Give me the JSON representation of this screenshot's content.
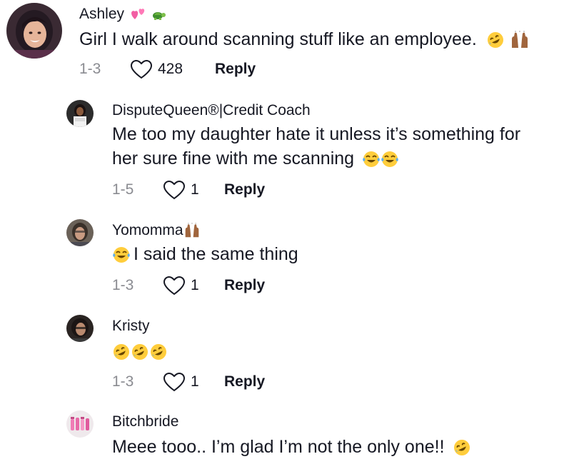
{
  "comments": [
    {
      "username": "Ashley",
      "text": "Girl I walk around scanning stuff like an employee.",
      "date": "1-3",
      "likes": "428",
      "reply_label": "Reply",
      "username_emojis": [
        "two-hearts",
        "turtle"
      ],
      "text_emojis": [
        "rofl",
        "raised-hands"
      ]
    },
    {
      "username": "DisputeQueen®|Credit  Coach",
      "text_line1": "Me too my daughter hate it unless it’s something for",
      "text_line2": "her sure fine with me scanning",
      "date": "1-5",
      "likes": "1",
      "reply_label": "Reply",
      "text_emojis": [
        "tears-of-joy",
        "tears-of-joy"
      ]
    },
    {
      "username": "Yomomma",
      "text": "I said the same thing",
      "date": "1-3",
      "likes": "1",
      "reply_label": "Reply",
      "username_emojis": [
        "raised-hands"
      ],
      "text_emojis": [
        "tears-of-joy"
      ]
    },
    {
      "username": "Kristy",
      "text": "",
      "date": "1-3",
      "likes": "1",
      "reply_label": "Reply",
      "text_emojis": [
        "rofl",
        "rofl",
        "rofl"
      ]
    },
    {
      "username": "Bitchbride",
      "text": "Meee tooo.. I’m glad I’m not the only one!!",
      "text_emojis": [
        "rofl"
      ]
    }
  ],
  "colors": {
    "text": "#161823",
    "muted": "#8a8b91",
    "background": "#ffffff"
  },
  "icons": {
    "like": "heart-outline-icon"
  }
}
